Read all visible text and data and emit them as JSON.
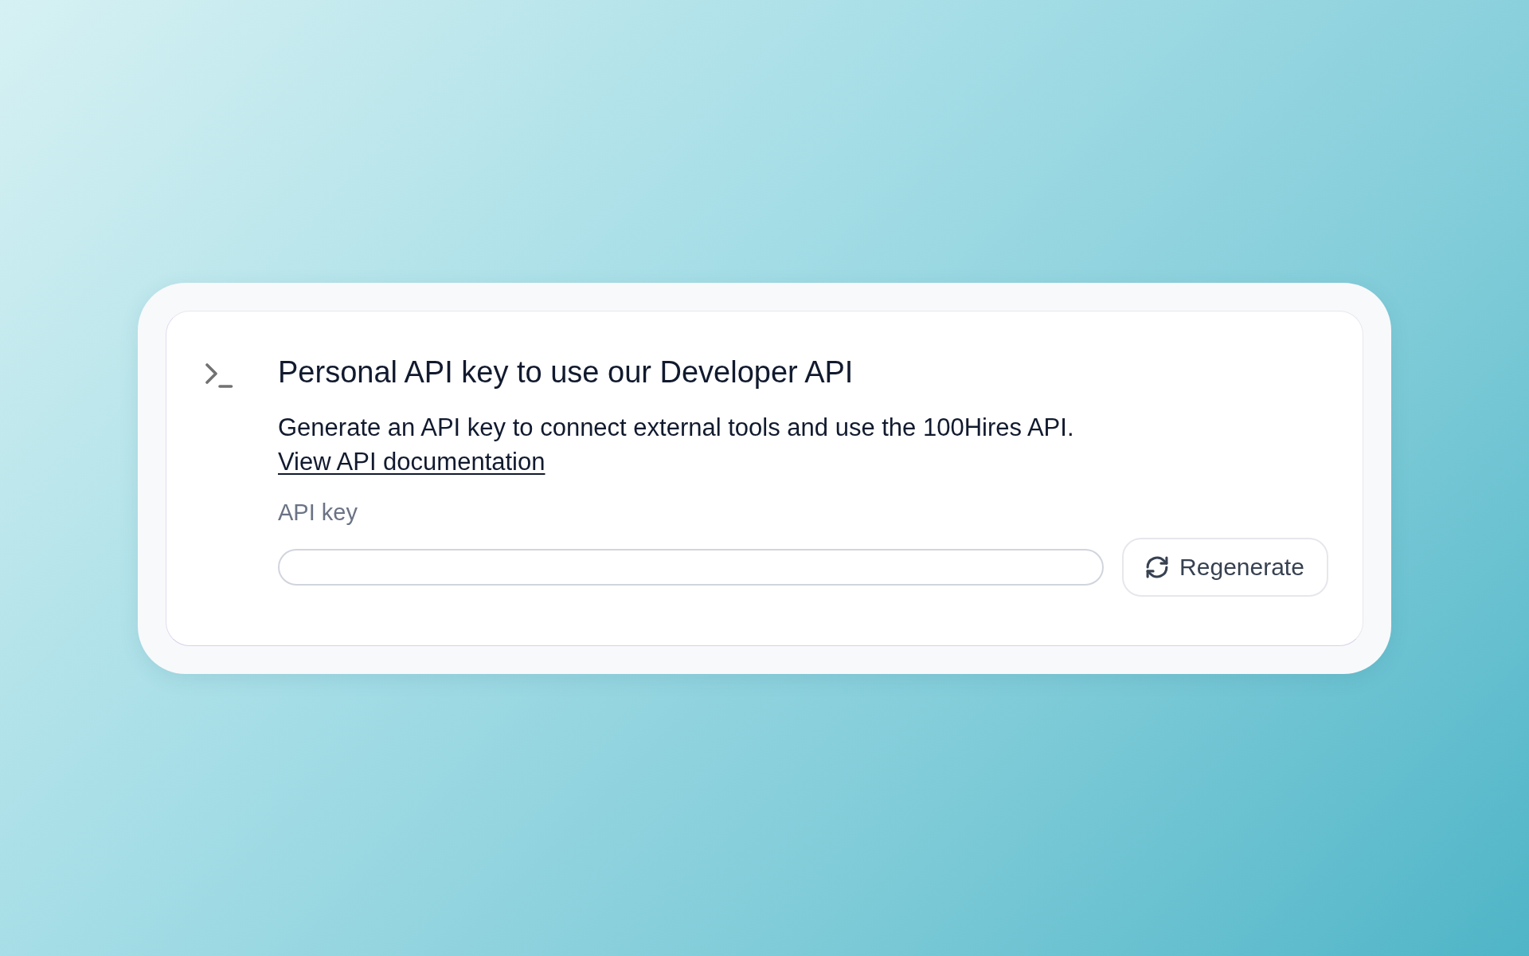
{
  "card": {
    "title": "Personal API key to use our Developer API",
    "description": {
      "text": "Generate an API key to connect external tools and use the 100Hires API.",
      "link": "View API documentation"
    },
    "api_key_field": {
      "label": "API key"
    },
    "regenerate_button": {
      "label": "Regenerate"
    }
  }
}
